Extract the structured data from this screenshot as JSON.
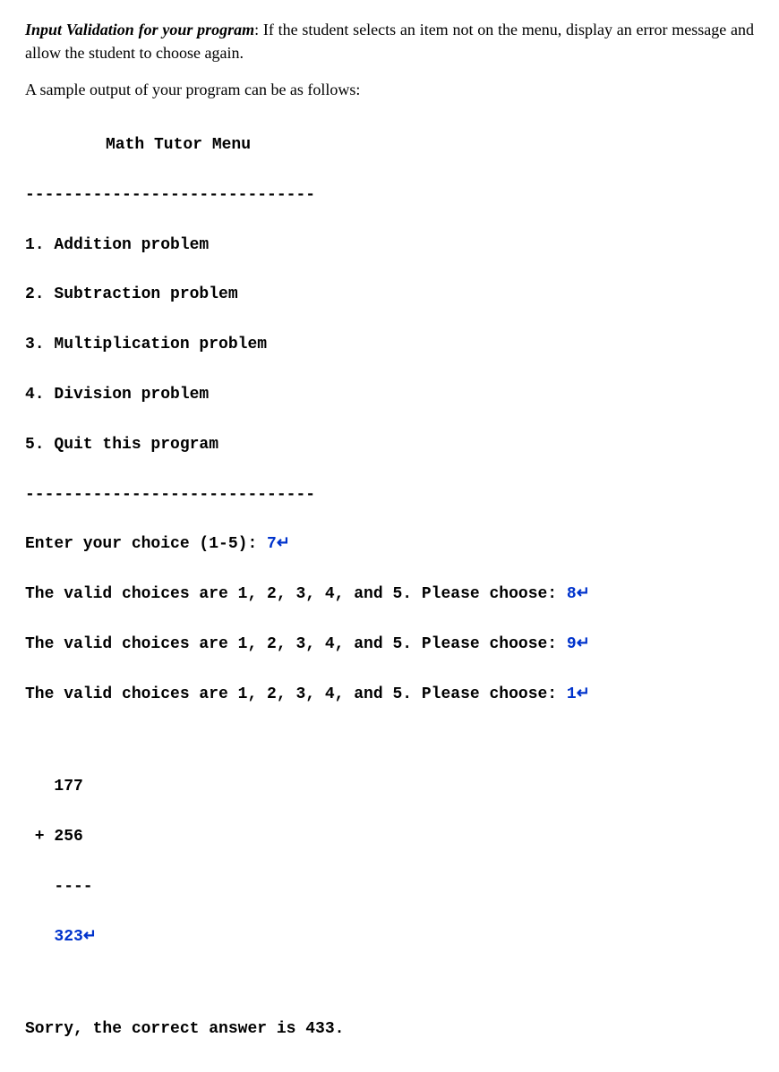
{
  "intro": {
    "lead": "Input Validation for your program",
    "text": ": If the student selects an item not on the menu, display an error message and allow the student to choose again."
  },
  "sample_label": "A sample output of your program can be as follows:",
  "console": {
    "title": "Math Tutor Menu",
    "divider": "------------------------------",
    "menu": [
      "1. Addition problem",
      "2. Subtraction problem",
      "3. Multiplication problem",
      "4. Division problem",
      "5. Quit this program"
    ],
    "prompt_label": "Enter your choice (1-5): ",
    "prompt_input": "7",
    "retry_label": "The valid choices are 1, 2, 3, 4, and 5. Please choose: ",
    "retries": [
      "8",
      "9",
      "1"
    ],
    "math": {
      "line1": "   177",
      "line2": " + 256",
      "rule": "   ----",
      "answer": "   323"
    },
    "result": "Sorry, the correct answer is 433.",
    "enter_symbol": "↵"
  }
}
